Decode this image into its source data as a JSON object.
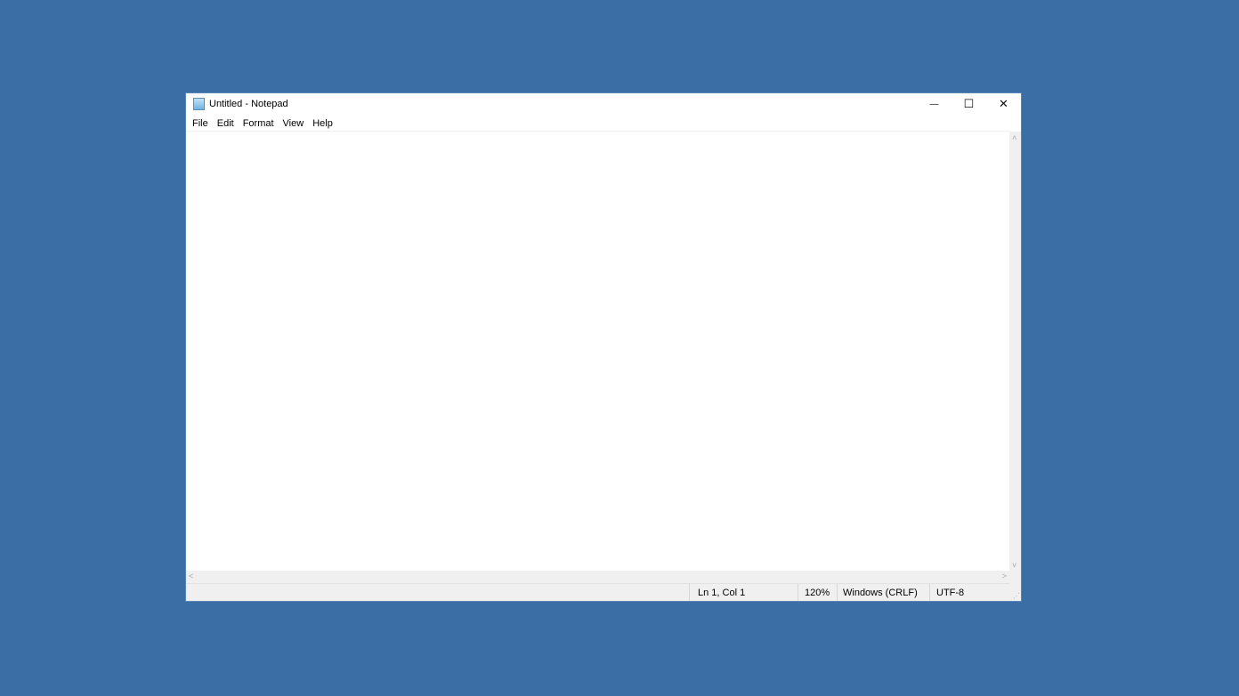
{
  "window": {
    "title": "Untitled - Notepad",
    "controls": {
      "minimize": "—",
      "maximize": "☐",
      "close": "✕"
    }
  },
  "menu": [
    "File",
    "Edit",
    "Format",
    "View",
    "Help"
  ],
  "editor": {
    "content": ""
  },
  "scroll": {
    "up": "˄",
    "down": "˅",
    "left": "<",
    "right": ">"
  },
  "status": {
    "position": "Ln 1, Col 1",
    "zoom": "120%",
    "line_ending": "Windows (CRLF)",
    "encoding": "UTF-8"
  }
}
